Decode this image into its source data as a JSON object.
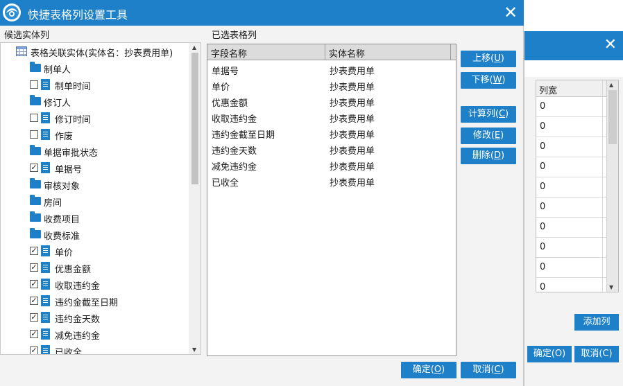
{
  "background_dialog": {
    "close_glyph": "✕",
    "column_header": "列宽",
    "values": [
      "0",
      "0",
      "0",
      "0",
      "0",
      "0",
      "0",
      "0",
      "0",
      "0"
    ],
    "add_column_label": "添加列",
    "confirm_label": "确定(O)",
    "cancel_label": "取消(C)"
  },
  "dialog": {
    "title": "快捷表格列设置工具",
    "close_glyph": "✕",
    "accent_color": "#1e80c8"
  },
  "candidates": {
    "header": "候选实体列",
    "tree": [
      {
        "label": "表格关联实体(实体名：抄表费用单)",
        "kind": "table",
        "icon": "table-icon"
      },
      {
        "label": "制单人",
        "kind": "folder",
        "icon": "folder-icon"
      },
      {
        "label": "制单时间",
        "kind": "field",
        "checked": false,
        "icon": "document-icon"
      },
      {
        "label": "修订人",
        "kind": "folder",
        "icon": "folder-icon"
      },
      {
        "label": "修订时间",
        "kind": "field",
        "checked": false,
        "icon": "document-icon"
      },
      {
        "label": "作废",
        "kind": "field",
        "checked": false,
        "icon": "document-icon"
      },
      {
        "label": "单据审批状态",
        "kind": "folder",
        "icon": "folder-icon"
      },
      {
        "label": "单据号",
        "kind": "field",
        "checked": true,
        "icon": "document-icon"
      },
      {
        "label": "审核对象",
        "kind": "folder",
        "icon": "folder-icon"
      },
      {
        "label": "房间",
        "kind": "folder",
        "icon": "folder-icon"
      },
      {
        "label": "收费项目",
        "kind": "folder",
        "icon": "folder-icon"
      },
      {
        "label": "收费标准",
        "kind": "folder",
        "icon": "folder-icon"
      },
      {
        "label": "单价",
        "kind": "field",
        "checked": true,
        "icon": "document-icon"
      },
      {
        "label": "优惠金额",
        "kind": "field",
        "checked": true,
        "icon": "document-icon"
      },
      {
        "label": "收取违约金",
        "kind": "field",
        "checked": true,
        "icon": "document-icon"
      },
      {
        "label": "违约金截至日期",
        "kind": "field",
        "checked": true,
        "icon": "document-icon"
      },
      {
        "label": "违约金天数",
        "kind": "field",
        "checked": true,
        "icon": "document-icon"
      },
      {
        "label": "减免违约金",
        "kind": "field",
        "checked": true,
        "icon": "document-icon"
      },
      {
        "label": "已收全",
        "kind": "field",
        "checked": true,
        "icon": "document-icon"
      }
    ]
  },
  "selected": {
    "header": "已选表格列",
    "columns": [
      "字段名称",
      "实体名称"
    ],
    "rows": [
      [
        "单据号",
        "抄表费用单"
      ],
      [
        "单价",
        "抄表费用单"
      ],
      [
        "优惠金额",
        "抄表费用单"
      ],
      [
        "收取违约金",
        "抄表费用单"
      ],
      [
        "违约金截至日期",
        "抄表费用单"
      ],
      [
        "违约金天数",
        "抄表费用单"
      ],
      [
        "减免违约金",
        "抄表费用单"
      ],
      [
        "已收全",
        "抄表费用单"
      ]
    ]
  },
  "actions": {
    "move_up": {
      "text": "上移(",
      "key": "U",
      "end": ")"
    },
    "move_down": {
      "text": "下移(",
      "key": "W",
      "end": ")"
    },
    "computed": {
      "text": "计算列(",
      "key": "C",
      "end": ")"
    },
    "edit": {
      "text": "修改(",
      "key": "E",
      "end": ")"
    },
    "delete": {
      "text": "删除(",
      "key": "D",
      "end": ")"
    }
  },
  "footer": {
    "confirm": {
      "text": "确定(",
      "key": "O",
      "end": ")"
    },
    "cancel": {
      "text": "取消(",
      "key": "C",
      "end": ")"
    }
  }
}
